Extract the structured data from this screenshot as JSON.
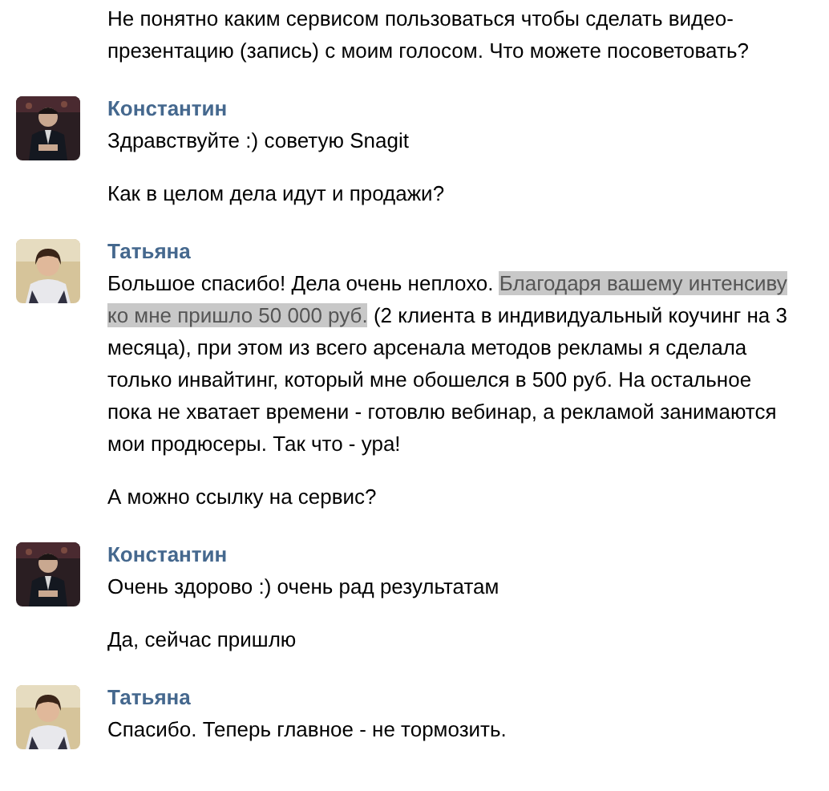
{
  "groups": [
    {
      "messages": [
        {
          "segments": [
            {
              "text": "Не понятно каким сервисом пользоваться чтобы сделать видео-презентацию (запись) с моим голосом. Что можете посоветовать?",
              "highlighted": false
            }
          ]
        }
      ]
    },
    {
      "author": {
        "name": "Константин",
        "kind": "dark"
      },
      "messages": [
        {
          "segments": [
            {
              "text": "Здравствуйте :) советую Snagit",
              "highlighted": false
            }
          ]
        },
        {
          "segments": [
            {
              "text": "Как в целом дела идут и продажи?",
              "highlighted": false
            }
          ]
        }
      ]
    },
    {
      "author": {
        "name": "Татьяна",
        "kind": "light"
      },
      "messages": [
        {
          "segments": [
            {
              "text": "Большое спасибо! Дела очень неплохо. ",
              "highlighted": false
            },
            {
              "text": "Благодаря вашему интенсиву ко мне пришло 50 000 руб.",
              "highlighted": true
            },
            {
              "text": " (2 клиента в индивидуальный коучинг на 3 месяца), при этом из всего арсенала методов рекламы я сделала только инвайтинг, который мне обошелся в 500 руб. На остальное пока не хватает времени - готовлю вебинар, а рекламой занимаются мои продюсеры. Так что - ура!",
              "highlighted": false
            }
          ]
        },
        {
          "segments": [
            {
              "text": "А можно ссылку на сервис?",
              "highlighted": false
            }
          ]
        }
      ]
    },
    {
      "author": {
        "name": "Константин",
        "kind": "dark"
      },
      "messages": [
        {
          "segments": [
            {
              "text": "Очень здорово :) очень рад результатам",
              "highlighted": false
            }
          ]
        },
        {
          "segments": [
            {
              "text": "Да, сейчас пришлю",
              "highlighted": false
            }
          ]
        }
      ]
    },
    {
      "author": {
        "name": "Татьяна",
        "kind": "light"
      },
      "messages": [
        {
          "segments": [
            {
              "text": "Спасибо. Теперь главное - не тормозить.",
              "highlighted": false
            }
          ]
        }
      ]
    }
  ]
}
